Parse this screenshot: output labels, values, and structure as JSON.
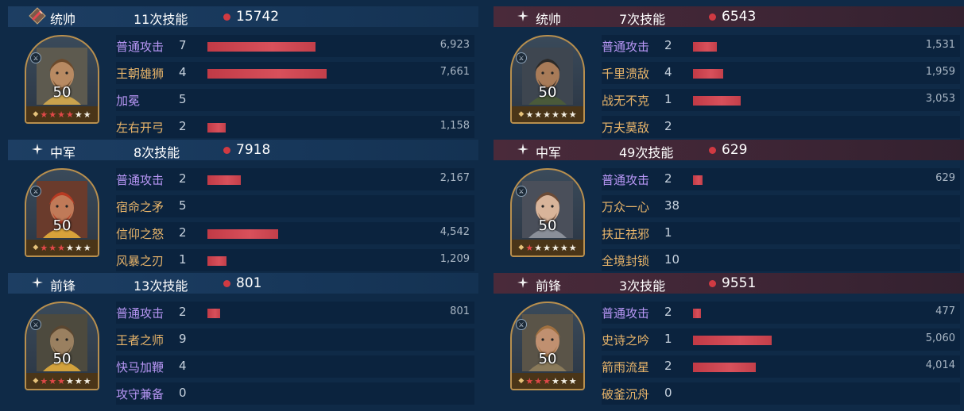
{
  "colors": {
    "purple_skill": "#b796f4",
    "gold_skill": "#e9b56a",
    "bar": "#c13a46",
    "left_header": "#1d3e63",
    "right_header": "#4a2a3a"
  },
  "max_damage": 7661,
  "left": {
    "sections": [
      {
        "emblem": "red-sword-diamond-icon",
        "position": "统帅",
        "skills_count": "11次技能",
        "total": "15742",
        "hero": {
          "level": "50",
          "red_stars": 4,
          "white_stars": 2,
          "palette": "king-a"
        },
        "skills": [
          {
            "name": "普通攻击",
            "color": "purple",
            "count": "7",
            "damage": 6923,
            "damage_text": "6,923"
          },
          {
            "name": "王朝雄狮",
            "color": "gold",
            "count": "4",
            "damage": 7661,
            "damage_text": "7,661"
          },
          {
            "name": "加冕",
            "color": "purple",
            "count": "5",
            "damage": 0,
            "damage_text": ""
          },
          {
            "name": "左右开弓",
            "color": "gold",
            "count": "2",
            "damage": 1158,
            "damage_text": "1,158"
          }
        ]
      },
      {
        "emblem": "sparkle-icon",
        "position": "中军",
        "skills_count": "8次技能",
        "total": "7918",
        "hero": {
          "level": "50",
          "red_stars": 3,
          "white_stars": 3,
          "palette": "red-beard"
        },
        "skills": [
          {
            "name": "普通攻击",
            "color": "purple",
            "count": "2",
            "damage": 2167,
            "damage_text": "2,167"
          },
          {
            "name": "宿命之矛",
            "color": "gold",
            "count": "5",
            "damage": 0,
            "damage_text": ""
          },
          {
            "name": "信仰之怒",
            "color": "gold",
            "count": "2",
            "damage": 4542,
            "damage_text": "4,542"
          },
          {
            "name": "风暴之刃",
            "color": "gold",
            "count": "1",
            "damage": 1209,
            "damage_text": "1,209"
          }
        ]
      },
      {
        "emblem": "sparkle-icon",
        "position": "前锋",
        "skills_count": "13次技能",
        "total": "801",
        "hero": {
          "level": "50",
          "red_stars": 3,
          "white_stars": 3,
          "palette": "golden-helm"
        },
        "skills": [
          {
            "name": "普通攻击",
            "color": "purple",
            "count": "2",
            "damage": 801,
            "damage_text": "801"
          },
          {
            "name": "王者之师",
            "color": "gold",
            "count": "9",
            "damage": 0,
            "damage_text": ""
          },
          {
            "name": "快马加鞭",
            "color": "purple",
            "count": "4",
            "damage": 0,
            "damage_text": ""
          },
          {
            "name": "攻守兼备",
            "color": "purple",
            "count": "0",
            "damage": 0,
            "damage_text": ""
          }
        ]
      }
    ]
  },
  "right": {
    "sections": [
      {
        "emblem": "sparkle-icon",
        "position": "统帅",
        "skills_count": "7次技能",
        "total": "6543",
        "hero": {
          "level": "50",
          "red_stars": 0,
          "white_stars": 6,
          "palette": "warlord"
        },
        "skills": [
          {
            "name": "普通攻击",
            "color": "purple",
            "count": "2",
            "damage": 1531,
            "damage_text": "1,531"
          },
          {
            "name": "千里溃敌",
            "color": "gold",
            "count": "4",
            "damage": 1959,
            "damage_text": "1,959"
          },
          {
            "name": "战无不克",
            "color": "gold",
            "count": "1",
            "damage": 3053,
            "damage_text": "3,053"
          },
          {
            "name": "万夫莫敌",
            "color": "gold",
            "count": "2",
            "damage": 0,
            "damage_text": ""
          }
        ]
      },
      {
        "emblem": "sparkle-icon",
        "position": "中军",
        "skills_count": "49次技能",
        "total": "629",
        "hero": {
          "level": "50",
          "red_stars": 1,
          "white_stars": 5,
          "palette": "maiden"
        },
        "skills": [
          {
            "name": "普通攻击",
            "color": "purple",
            "count": "2",
            "damage": 629,
            "damage_text": "629"
          },
          {
            "name": "万众一心",
            "color": "gold",
            "count": "38",
            "damage": 0,
            "damage_text": ""
          },
          {
            "name": "扶正祛邪",
            "color": "gold",
            "count": "1",
            "damage": 0,
            "damage_text": ""
          },
          {
            "name": "全境封锁",
            "color": "gold",
            "count": "10",
            "damage": 0,
            "damage_text": ""
          }
        ]
      },
      {
        "emblem": "sparkle-icon",
        "position": "前锋",
        "skills_count": "3次技能",
        "total": "9551",
        "hero": {
          "level": "50",
          "red_stars": 3,
          "white_stars": 3,
          "palette": "archer"
        },
        "skills": [
          {
            "name": "普通攻击",
            "color": "purple",
            "count": "2",
            "damage": 477,
            "damage_text": "477"
          },
          {
            "name": "史诗之吟",
            "color": "gold",
            "count": "1",
            "damage": 5060,
            "damage_text": "5,060"
          },
          {
            "name": "箭雨流星",
            "color": "gold",
            "count": "2",
            "damage": 4014,
            "damage_text": "4,014"
          },
          {
            "name": "破釜沉舟",
            "color": "gold",
            "count": "0",
            "damage": 0,
            "damage_text": ""
          }
        ]
      }
    ]
  }
}
